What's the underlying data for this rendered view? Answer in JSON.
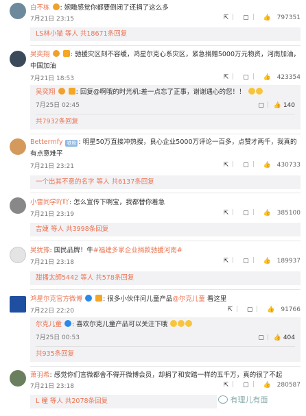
{
  "comments": [
    {
      "name": "白不栋",
      "text": "婉瞰感觉你都要倒闭了还捐了这么多",
      "time": "7月21日 23:15",
      "likes": "797351",
      "reply_summary": {
        "name": "LS林小猫",
        "rest": "等人 共18671条回复"
      }
    },
    {
      "name": "吴奕翔",
      "text": "驰援灾区刻不容缓，鸿星尔克心系灾区，紧急捐赠5000万元物资，河南加油，中国加油",
      "time": "7月21日 18:53",
      "likes": "423354",
      "reply": {
        "name": "吴奕翔",
        "text": "回复@啊哦的时光机:差一点忘了正事，谢谢遇心的您！！",
        "time": "7月25日 02:45",
        "likes": "140"
      },
      "reply_count": "共7932条回复"
    },
    {
      "name": "Bettermfy",
      "tag": "铁粉",
      "text": "明星50万直接冲热搜，良心企业5000万评论一百多，点赞才两千，我真的有点意难平",
      "time": "7月21日 23:21",
      "likes": "430733",
      "reply_summary": {
        "name": "一个出其不意的名字",
        "rest": "等人 共6137条回复"
      }
    },
    {
      "name": "小雷同学吖吖",
      "text": "怎么宣传下啊宝，我都替你着急",
      "time": "7月21日 23:19",
      "likes": "385100",
      "reply_summary": {
        "name": "吉婕",
        "rest": "等人 共3998条回复"
      }
    },
    {
      "name": "吴犹豫",
      "text": "国民品牌！牛",
      "tagtext": "#福建多家企业捐款驰援河南#",
      "time": "7月21日 23:18",
      "likes": "189937",
      "reply_summary": {
        "name": "甜播太師5442",
        "rest": "等人 共578条回复"
      }
    },
    {
      "name": "鸿星尔克官方微博",
      "text": "很多小伙伴问儿童产品",
      "mention": "@尔克儿童",
      "text_end": " 看这里",
      "time": "7月22日 22:20",
      "likes": "91766",
      "reply": {
        "name": "尔克儿童",
        "text": "喜欢尔克儿童产品可以关注下哦",
        "time": "7月25日 00:53",
        "likes": "404"
      },
      "reply_count": "共935条回复"
    },
    {
      "name": "萧羽希",
      "text": "感觉你们言微都舍不得开微博会员，却捐了和安踏一样的五千万，真的很了不起",
      "time": "7月21日 23:18",
      "likes": "280587",
      "reply_summary": {
        "name": "L 瞳",
        "rest": "等人 共2078条回复"
      }
    }
  ],
  "watermark": "有理儿有面",
  "colors": {
    "accent": "#eb7350",
    "reply_bg": "#f2f2f5"
  }
}
